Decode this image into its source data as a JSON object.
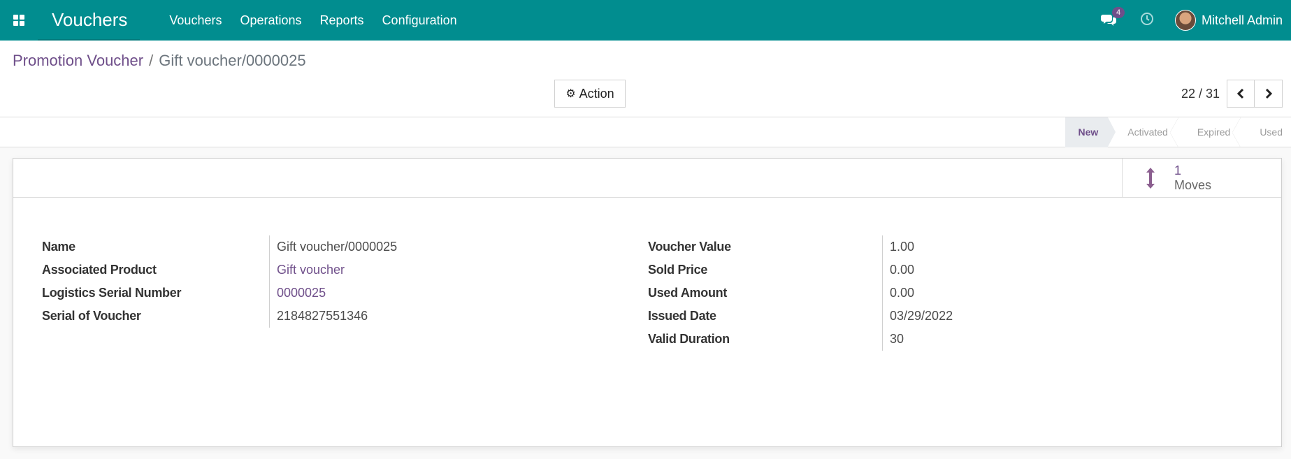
{
  "navbar": {
    "app_title": "Vouchers",
    "menu": [
      "Vouchers",
      "Operations",
      "Reports",
      "Configuration"
    ],
    "messages_count": "4",
    "user_name": "Mitchell Admin",
    "icons": {
      "apps": "apps-grid-icon",
      "chat": "chat-bubble-icon",
      "activity": "clock-icon"
    }
  },
  "breadcrumb": {
    "parent": "Promotion Voucher",
    "separator": "/",
    "current": "Gift voucher/0000025"
  },
  "toolbar": {
    "action_label": "Action"
  },
  "pager": {
    "value": "22 / 31"
  },
  "statusbar": {
    "stages": [
      "New",
      "Activated",
      "Expired",
      "Used"
    ],
    "active": "New"
  },
  "smart_button": {
    "value": "1",
    "label": "Moves"
  },
  "fields_left": [
    {
      "label": "Name",
      "value": "Gift voucher/0000025",
      "link": false
    },
    {
      "label": "Associated Product",
      "value": "Gift voucher",
      "link": true
    },
    {
      "label": "Logistics Serial Number",
      "value": "0000025",
      "link": true
    },
    {
      "label": "Serial of Voucher",
      "value": "2184827551346",
      "link": false
    }
  ],
  "fields_right": [
    {
      "label": "Voucher Value",
      "value": "1.00"
    },
    {
      "label": "Sold Price",
      "value": "0.00"
    },
    {
      "label": "Used Amount",
      "value": "0.00"
    },
    {
      "label": "Issued Date",
      "value": "03/29/2022"
    },
    {
      "label": "Valid Duration",
      "value": "30"
    }
  ],
  "colors": {
    "navbar": "#018d8f",
    "accent": "#6f4f8a"
  }
}
